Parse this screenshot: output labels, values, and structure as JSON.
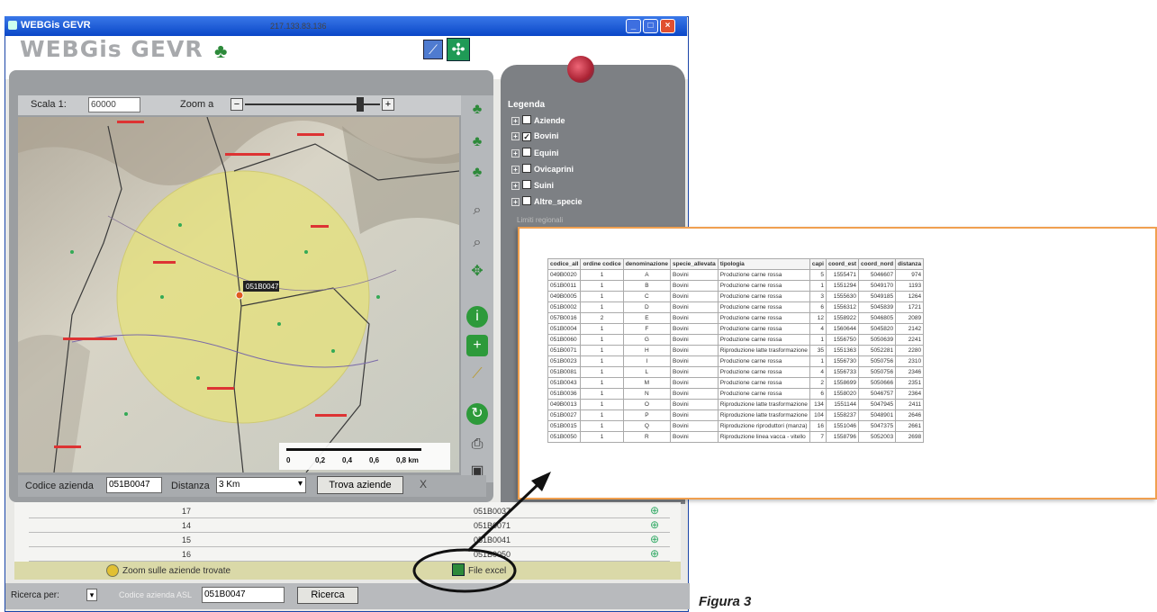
{
  "window": {
    "title": "WEBGis GEVR",
    "ip": "217.133.83.136",
    "logo_text": "WEBGis GEVR",
    "controls": [
      "minimize",
      "maximize",
      "close"
    ]
  },
  "map_toolbar": {
    "scale_label": "Scala 1:",
    "scale_value": "60000",
    "zoom_label": "Zoom a",
    "zoom_minus": "−",
    "zoom_plus": "+",
    "zoom_level": 0.85
  },
  "map": {
    "selected_marker_label": "051B0047",
    "scale_ticks": [
      "0",
      "0,2",
      "0,4",
      "0,6",
      "0,8 km"
    ]
  },
  "vertical_tools": [
    "tree-icon",
    "zoom-in-tree-icon",
    "zoom-out-tree-icon",
    "zoom-in-icon",
    "zoom-out-icon",
    "pan-icon",
    "info-icon",
    "layer-add-icon",
    "measure-icon",
    "refresh-icon",
    "print-icon",
    "save-icon"
  ],
  "aziende_search": {
    "codice_label": "Codice azienda",
    "codice_value": "051B0047",
    "distanza_label": "Distanza",
    "distanza_value": "3 Km",
    "trova_button": "Trova aziende",
    "clear": "X"
  },
  "results": {
    "rows": [
      {
        "c1": "17",
        "c2": "051B0037"
      },
      {
        "c1": "14",
        "c2": "051B0071"
      },
      {
        "c1": "15",
        "c2": "051B0041"
      },
      {
        "c1": "16",
        "c2": "051B0050"
      }
    ],
    "zoom_all_label": "Zoom sulle aziende trovate",
    "file_excel_label": "File excel"
  },
  "search_bar": {
    "ricerca_per_label": "Ricerca per:",
    "field_label": "Codice azienda ASL",
    "input_value": "051B0047",
    "ricerca_button": "Ricerca"
  },
  "legend": {
    "title": "Legenda",
    "items": [
      {
        "label": "Aziende",
        "checked": false
      },
      {
        "label": "Bovini",
        "checked": true
      },
      {
        "label": "Equini",
        "checked": false
      },
      {
        "label": "Ovicaprini",
        "checked": false
      },
      {
        "label": "Suini",
        "checked": false
      },
      {
        "label": "Altre_specie",
        "checked": false
      }
    ],
    "sub": "Limiti regionali"
  },
  "table": {
    "headers": [
      "codice_all",
      "ordine codice",
      "denominazione",
      "specie_allevata",
      "tipologia",
      "capi",
      "coord_est",
      "coord_nord",
      "distanza"
    ],
    "rows": [
      [
        "049B0020",
        "1",
        "A",
        "Bovini",
        "Produzione carne rossa",
        "5",
        "1555471",
        "5046607",
        "974"
      ],
      [
        "051B0011",
        "1",
        "B",
        "Bovini",
        "Produzione carne rossa",
        "1",
        "1551294",
        "5049170",
        "1193"
      ],
      [
        "049B0005",
        "1",
        "C",
        "Bovini",
        "Produzione carne rossa",
        "3",
        "1555630",
        "5049185",
        "1264"
      ],
      [
        "051B0002",
        "1",
        "D",
        "Bovini",
        "Produzione carne rossa",
        "6",
        "1556312",
        "5045839",
        "1721"
      ],
      [
        "057B0016",
        "2",
        "E",
        "Bovini",
        "Produzione carne rossa",
        "12",
        "1558922",
        "5046805",
        "2089"
      ],
      [
        "051B0004",
        "1",
        "F",
        "Bovini",
        "Produzione carne rossa",
        "4",
        "1560644",
        "5045820",
        "2142"
      ],
      [
        "051B0060",
        "1",
        "G",
        "Bovini",
        "Produzione carne rossa",
        "1",
        "1556750",
        "5050639",
        "2241"
      ],
      [
        "051B0071",
        "1",
        "H",
        "Bovini",
        "Riproduzione latte trasformazione",
        "35",
        "1551363",
        "5052281",
        "2280"
      ],
      [
        "051B0023",
        "1",
        "I",
        "Bovini",
        "Produzione carne rossa",
        "1",
        "1556730",
        "5050756",
        "2310"
      ],
      [
        "051B0081",
        "1",
        "L",
        "Bovini",
        "Produzione carne rossa",
        "4",
        "1556733",
        "5050756",
        "2346"
      ],
      [
        "051B0043",
        "1",
        "M",
        "Bovini",
        "Produzione carne rossa",
        "2",
        "1558699",
        "5050666",
        "2351"
      ],
      [
        "051B0036",
        "1",
        "N",
        "Bovini",
        "Produzione carne rossa",
        "6",
        "1558020",
        "5046757",
        "2364"
      ],
      [
        "049B0013",
        "1",
        "O",
        "Bovini",
        "Riproduzione latte trasformazione",
        "134",
        "1551144",
        "5047945",
        "2411"
      ],
      [
        "051B0027",
        "1",
        "P",
        "Bovini",
        "Riproduzione latte trasformazione",
        "104",
        "1558237",
        "5048901",
        "2646"
      ],
      [
        "051B0015",
        "1",
        "Q",
        "Bovini",
        "Riproduzione riproduttori (manza)",
        "16",
        "1551046",
        "5047375",
        "2661"
      ],
      [
        "051B0050",
        "1",
        "R",
        "Bovini",
        "Riproduzione linea vacca - vitello",
        "7",
        "1558796",
        "5052003",
        "2698"
      ]
    ]
  },
  "caption": "Figura 3"
}
